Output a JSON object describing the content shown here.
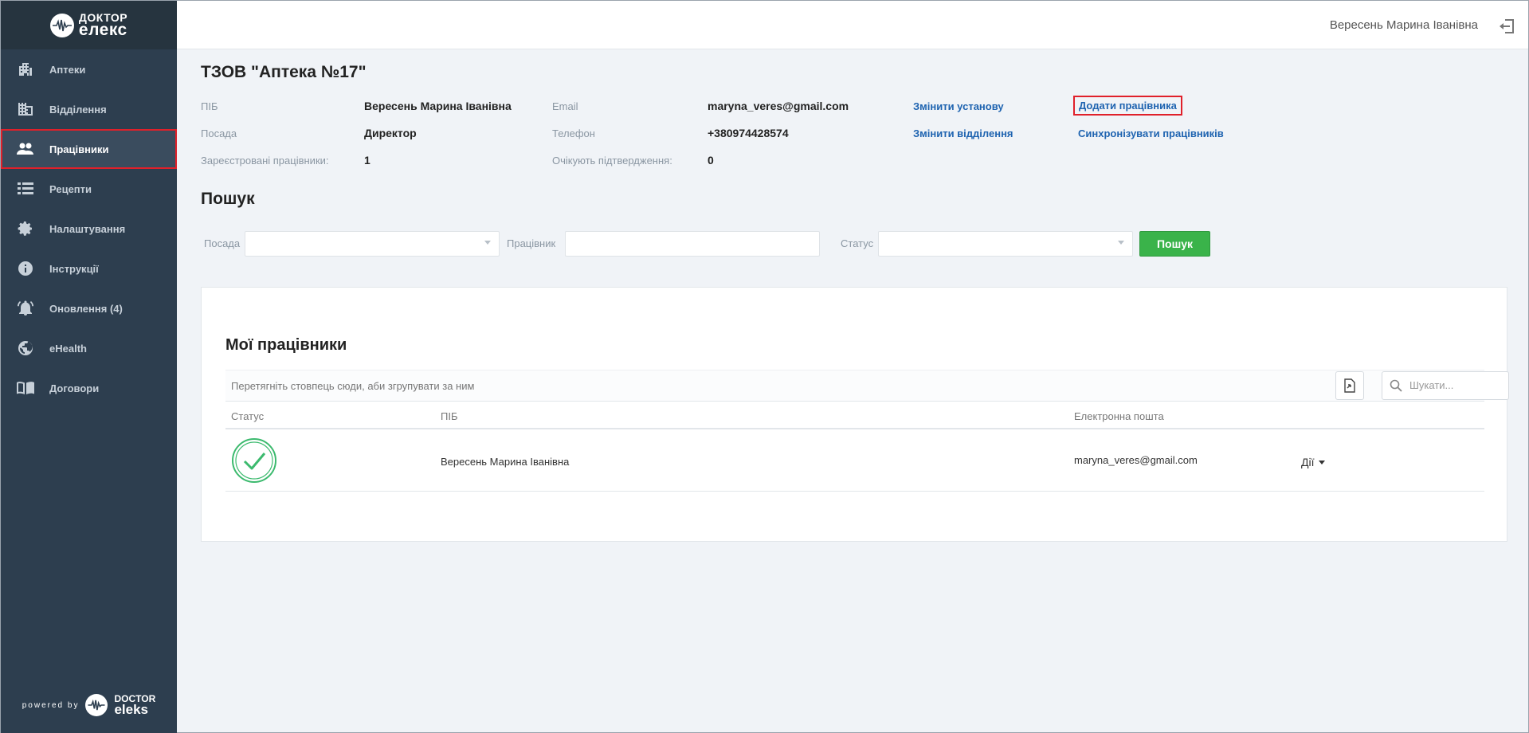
{
  "brand": {
    "line1": "ДОКТОР",
    "line2": "елекс"
  },
  "powered": {
    "prefix": "powered by",
    "line1": "DOCTOR",
    "line2": "eleks"
  },
  "sidebar": {
    "items": [
      {
        "label": "Аптеки",
        "icon": "building-icon"
      },
      {
        "label": "Відділення",
        "icon": "branch-building-icon"
      },
      {
        "label": "Працівники",
        "icon": "users-icon",
        "active": true
      },
      {
        "label": "Рецепти",
        "icon": "list-icon"
      },
      {
        "label": "Налаштування",
        "icon": "gear-icon"
      },
      {
        "label": "Інструкції",
        "icon": "info-icon"
      },
      {
        "label": "Оновлення (4)",
        "icon": "bell-icon"
      },
      {
        "label": "eHealth",
        "icon": "globe-icon"
      },
      {
        "label": "Договори",
        "icon": "book-icon"
      }
    ]
  },
  "header": {
    "user": "Вересень Марина Іванівна"
  },
  "org": {
    "title": "ТЗОВ \"Аптека №17\"",
    "pib_label": "ПІБ",
    "pib_value": "Вересень Марина Іванівна",
    "position_label": "Посада",
    "position_value": "Директор",
    "registered_label": "Зареєстровані працівники:",
    "registered_value": "1",
    "email_label": "Email",
    "email_value": "maryna_veres@gmail.com",
    "phone_label": "Телефон",
    "phone_value": "+380974428574",
    "pending_label": "Очікують підтвердження:",
    "pending_value": "0",
    "change_institution": "Змінити установу",
    "change_branch": "Змінити відділення",
    "add_employee": "Додати працівника",
    "sync_employees": "Синхронізувати працівників"
  },
  "search": {
    "title": "Пошук",
    "position_label": "Посада",
    "position_value": "",
    "employee_label": "Працівник",
    "employee_value": "",
    "status_label": "Статус",
    "status_value": "",
    "button": "Пошук"
  },
  "employees": {
    "title": "Мої працівники",
    "group_hint": "Перетягніть стовпець сюди, аби згрупувати за ним",
    "find_placeholder": "Шукати...",
    "columns": {
      "status": "Статус",
      "name": "ПІБ",
      "email": "Електронна пошта"
    },
    "rows": [
      {
        "status": "confirmed",
        "name": "Вересень Марина Іванівна",
        "email": "maryna_veres@gmail.com",
        "actions": "Дії"
      }
    ]
  },
  "colors": {
    "sidebar": "#2d3e4f",
    "accent_link": "#1e63b0",
    "button_green": "#3ab34a",
    "highlight": "#e0202a",
    "status_ok": "#3cba6e"
  }
}
